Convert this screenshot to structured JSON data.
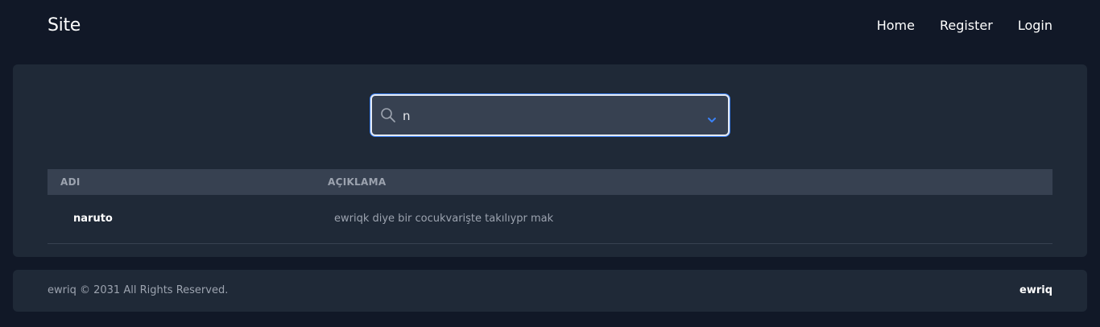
{
  "navbar": {
    "brand": "Site",
    "links": [
      {
        "label": "Home"
      },
      {
        "label": "Register"
      },
      {
        "label": "Login"
      }
    ]
  },
  "search": {
    "value": "n",
    "icon": "search-icon",
    "dropdown_icon": "chevron-down-icon",
    "focus_color": "#3b82f6"
  },
  "table": {
    "headers": [
      "ADI",
      "AÇIKLAMA"
    ],
    "rows": [
      {
        "name": "naruto",
        "description": "ewriqk diye bir cocukvarişte takılıypr mak"
      }
    ]
  },
  "footer": {
    "copyright": "ewriq © 2031 All Rights Reserved.",
    "brand": "ewriq"
  },
  "colors": {
    "background": "#111827",
    "card": "#1f2937",
    "table_header": "#374151",
    "muted_text": "#9ca3af"
  }
}
